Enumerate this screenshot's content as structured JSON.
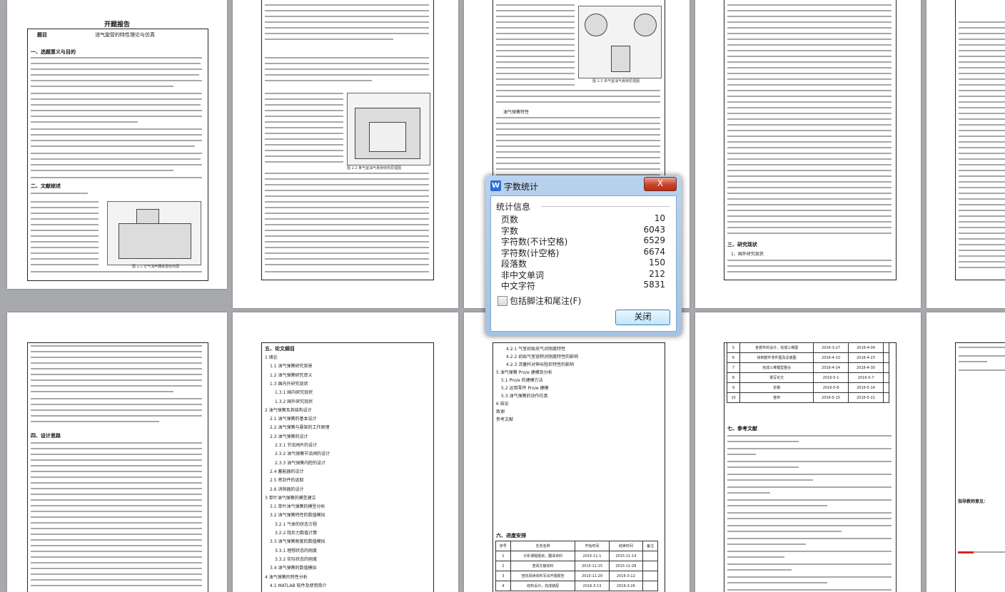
{
  "document": {
    "page1_title": "开题报告",
    "page1_subject_label": "题目",
    "page1_subject": "消气旋管的特性理论与仿真",
    "page1_h1": "一、选题意义与目的",
    "page1_h2": "二、文献综述",
    "page1_fig_caption": "图 2.1 空气消声器装置结构图",
    "page1_sections": [
      "一、选题意义与目的",
      "二、文献综述"
    ],
    "page2_fig_caption": "图 2.2 某气室油气悬架结构原理图",
    "page3_fig_caption": "图 2.3 单气室油气悬架原理图",
    "page3_subtitle": "油气弹簧特性",
    "page4_h1": "三、研究现状",
    "page4_h2": "1、国外研究现状",
    "page5_h1": "四、设计思路",
    "page6_h1": "五、论文纲目",
    "page6_toc": [
      "1 绪论",
      "1.1 油气弹簧研究背景",
      "1.2 油气弹簧研究意义",
      "1.3 国内外研究现状",
      "1.3.1 国内研究现状",
      "1.3.2 国外研究现状",
      "2 油气弹簧及其结构设计",
      "2.1 油气弹簧的基本设计",
      "2.2 油气弹簧与悬架的工作原理",
      "2.3 油气弹簧的设计",
      "2.3.1 节流阀片的设计",
      "2.3.2 油气弹簧节流阀的设计",
      "2.3.3 油气弹簧内腔的设计",
      "2.4 蓄能器的设计",
      "2.5 密封件的选取",
      "2.6 消除器的设计",
      "3 单叶油气弹簧的模型建立",
      "3.1 单叶油气弹簧的模型分析",
      "3.2 油气弹簧特性的数值模拟",
      "3.2.1 气体的状态方程",
      "3.2.2 阻尼力数值计算",
      "3.3 油气弹簧刚度的数值模拟",
      "3.3.1 理想状态的刚度",
      "3.3.2 实际状态的刚度",
      "3.4 油气弹簧的数值模拟",
      "4 油气弹簧的特性分析",
      "4.1 MATLAB 软件及使用简介"
    ],
    "page7_toc": [
      "4.2.1 气室初始充气对刚度特性",
      "4.2.2 初始气室容积对刚度特性的影响",
      "4.2.3 活塞杆对伸长阻尼特性的影响",
      "5 油气弹簧 Pro/e 建模及分析",
      "5.1 Pro/e 的建模方法",
      "5.2 运用零件 Pro/e 建模",
      "5.3 油气弹簧的动作仿真",
      "6 结论",
      "致谢",
      "参考文献"
    ],
    "page7_h1": "六、进度安排",
    "page7_schedule_headers": [
      "序号",
      "任务名称",
      "开始时间",
      "结束时间",
      "备注"
    ],
    "page7_schedule": [
      [
        "1",
        "分析课题题目，翻译资料",
        "2015-11-1",
        "2015-11-14",
        ""
      ],
      [
        "2",
        "查阅文献资料",
        "2015-11-15",
        "2015-11-28",
        ""
      ],
      [
        "3",
        "查找阅读资料写出开题报告",
        "2015-11-29",
        "2016-3-12",
        ""
      ],
      [
        "4",
        "结构设计，完成装配",
        "2016-3-13",
        "2016-3-26",
        ""
      ]
    ],
    "page8_schedule": [
      [
        "5",
        "各部件的设计，完成三维图",
        "2016-3-27",
        "2016-4-09",
        ""
      ],
      [
        "6",
        "绘制部件零件图及总装图",
        "2016-4-10",
        "2016-4-23",
        ""
      ],
      [
        "7",
        "完成三维模型整合",
        "2016-4-24",
        "2016-4-30",
        ""
      ],
      [
        "8",
        "撰写论文",
        "2016-5-1",
        "2016-5-7",
        ""
      ],
      [
        "9",
        "定稿",
        "2016-5-8",
        "2016-5-14",
        ""
      ],
      [
        "10",
        "答辩",
        "2016-5-15",
        "2016-5-21",
        ""
      ]
    ],
    "page8_h1": "七、参考文献",
    "page9_review": "指导教师意见："
  },
  "dialog": {
    "title": "字数统计",
    "app_icon": "W",
    "close_symbol": "X",
    "section": "统计信息",
    "stats": [
      {
        "label": "页数",
        "value": "10"
      },
      {
        "label": "字数",
        "value": "6043"
      },
      {
        "label": "字符数(不计空格)",
        "value": "6529"
      },
      {
        "label": "字符数(计空格)",
        "value": "6674"
      },
      {
        "label": "段落数",
        "value": "150"
      },
      {
        "label": "非中文单词",
        "value": "212"
      },
      {
        "label": "中文字符",
        "value": "5831"
      }
    ],
    "include_footnotes_label": "包括脚注和尾注(F)",
    "include_footnotes_checked": false,
    "close_button_label": "关闭"
  }
}
